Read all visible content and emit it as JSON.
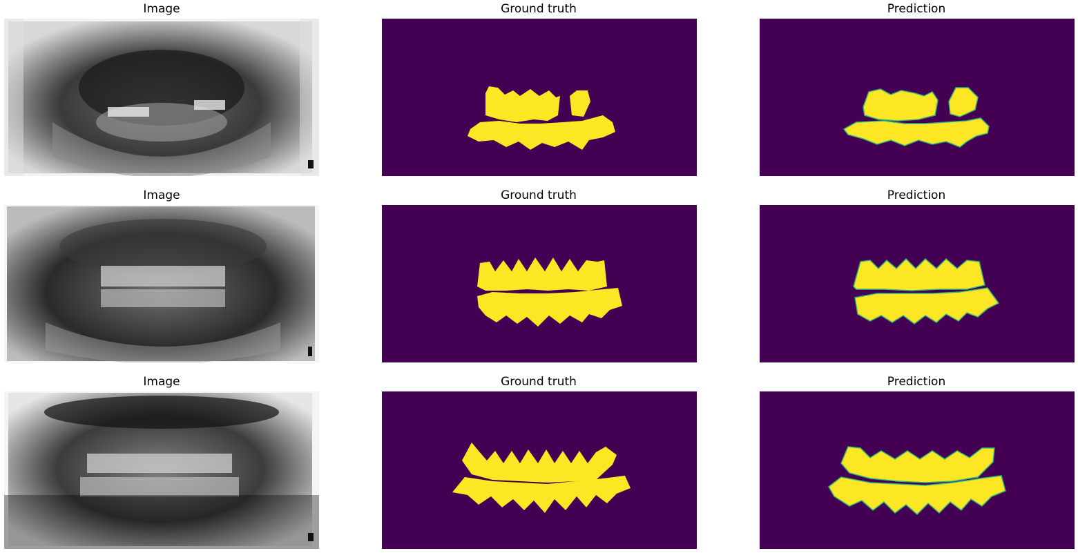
{
  "rows": [
    {
      "image_title": "Image",
      "gt_title": "Ground truth",
      "pred_title": "Prediction"
    },
    {
      "image_title": "Image",
      "gt_title": "Ground truth",
      "pred_title": "Prediction"
    },
    {
      "image_title": "Image",
      "gt_title": "Ground truth",
      "pred_title": "Prediction"
    }
  ],
  "colors": {
    "mask_background": "#440154",
    "mask_foreground": "#fde725",
    "mask_edge": "#35b779"
  }
}
